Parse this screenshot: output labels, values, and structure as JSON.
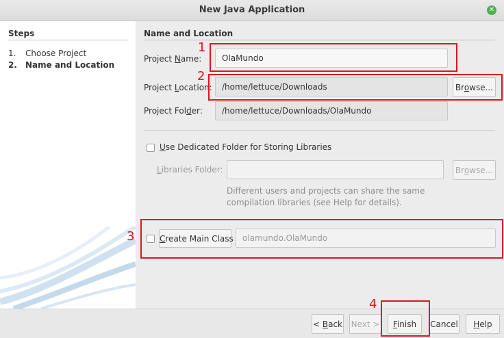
{
  "window": {
    "title": "New Java Application"
  },
  "steps": {
    "title": "Steps",
    "items": [
      {
        "number": "1.",
        "label": "Choose Project"
      },
      {
        "number": "2.",
        "label": "Name and Location"
      }
    ]
  },
  "section": {
    "heading": "Name and Location"
  },
  "form": {
    "project_name_label_a": "Project ",
    "project_name_label_u": "N",
    "project_name_label_b": "ame:",
    "project_name_value": "OlaMundo",
    "project_location_label_a": "Project ",
    "project_location_label_u": "L",
    "project_location_label_b": "ocation:",
    "project_location_value": "/home/lettuce/Downloads",
    "browse_a": "Br",
    "browse_u": "o",
    "browse_b": "wse...",
    "project_folder_label_a": "Project Fol",
    "project_folder_label_u": "d",
    "project_folder_label_b": "er:",
    "project_folder_value": "/home/lettuce/Downloads/OlaMundo",
    "dedicated_u": "U",
    "dedicated_rest": "se Dedicated Folder for Storing Libraries",
    "libraries_label_u": "L",
    "libraries_label_rest": "ibraries Folder:",
    "libraries_browse_a": "Br",
    "libraries_browse_u": "o",
    "libraries_browse_b": "wse...",
    "note_line1": "Different users and projects can share the same",
    "note_line2": "compilation libraries (see Help for details).",
    "main_class_u": "C",
    "main_class_rest": "reate Main Class",
    "main_class_value": "olamundo.OlaMundo"
  },
  "footer": {
    "back_a": "< ",
    "back_u": "B",
    "back_b": "ack",
    "next": "Next >",
    "finish_u": "F",
    "finish_b": "inish",
    "cancel": "Cancel",
    "help_u": "H",
    "help_b": "elp"
  },
  "annotations": {
    "n1": "1",
    "n2": "2",
    "n3": "3",
    "n4": "4",
    "color": "#e0141e"
  },
  "icons": {
    "close": "close-icon",
    "wizard": "wizard-graphic"
  }
}
